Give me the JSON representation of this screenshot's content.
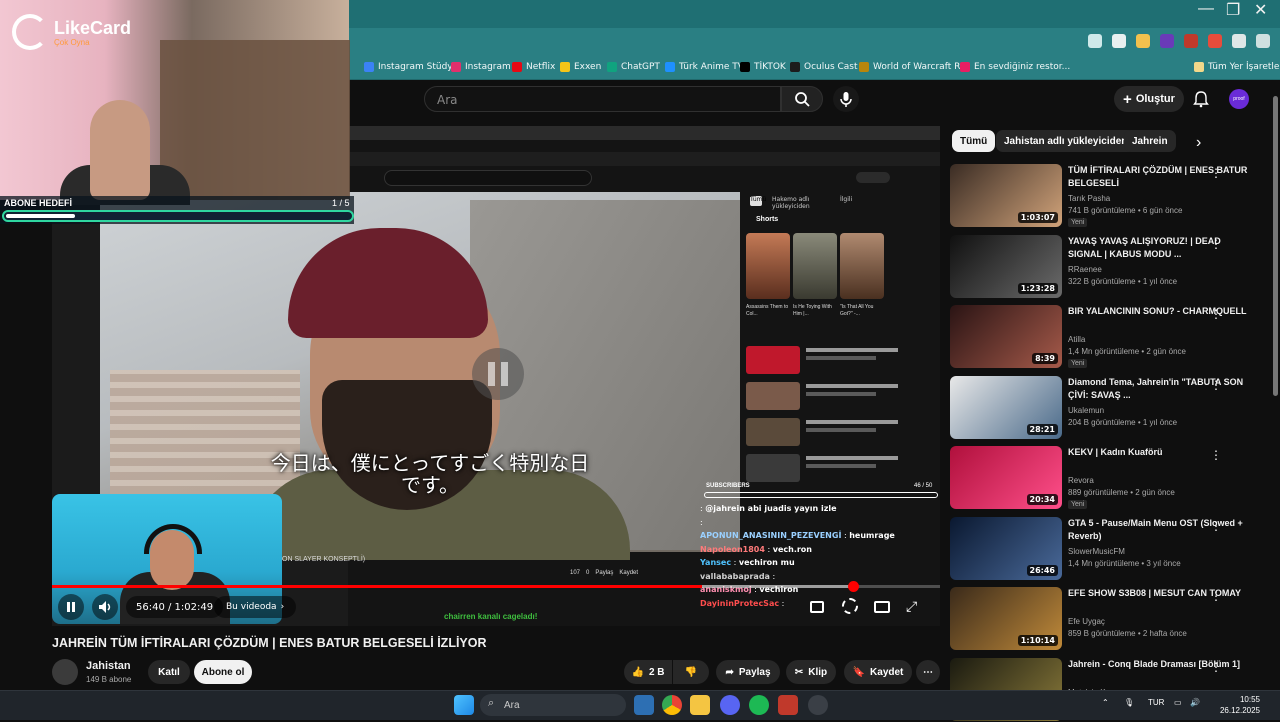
{
  "stream_overlay": {
    "logo_text": "LikeCard",
    "logo_sub": "Çok Oyna",
    "goal_label": "ABONE HEDEFİ",
    "goal_count": "1 / 5",
    "goal_progress": 0.2
  },
  "bookmarks": [
    {
      "label": "Instagram Stüdyo",
      "color": "#3b82f6"
    },
    {
      "label": "Instagram",
      "color": "#e1306c"
    },
    {
      "label": "Netflix",
      "color": "#e50914"
    },
    {
      "label": "Exxen",
      "color": "#f5c518"
    },
    {
      "label": "ChatGPT",
      "color": "#10a37f"
    },
    {
      "label": "Türk Anime TV",
      "color": "#1e90ff"
    },
    {
      "label": "TİKTOK",
      "color": "#000000"
    },
    {
      "label": "Oculus Cast",
      "color": "#1c1c1c"
    },
    {
      "label": "World of Warcraft R...",
      "color": "#b8860b"
    },
    {
      "label": "En sevdiğiniz restor...",
      "color": "#e91e63"
    }
  ],
  "bookmarks_all": "Tüm Yer İşaretleri",
  "header": {
    "search_placeholder": "Ara",
    "create_label": "Oluştur",
    "avatar_text": "proof"
  },
  "player": {
    "subtitle_line1": "今日は、僕にとってすごく特別な日",
    "subtitle_line2": "です。",
    "time": "56:40 / 1:02:49",
    "chapter": "Bu videoda",
    "progress": 0.902,
    "accent": "#ff0000"
  },
  "inner": {
    "chips": [
      "Tümü",
      "Hakemo adlı yükleyiciden",
      "İlgili"
    ],
    "shorts_label": "Shorts",
    "shorts": [
      "Assassins Them to Col...",
      "Is He Toying With Him |...",
      "\"Is That All You Got?\" -..."
    ],
    "bottom_caption": "ON SLAYER KONSEPTLİ)",
    "bottom_actions": [
      "107",
      "0",
      "Paylaş",
      "Kaydet"
    ]
  },
  "chat": {
    "sub_label": "SUBSCRIBERS",
    "sub_count": "46 / 50",
    "messages": [
      {
        "user": "",
        "text": "@jahrein abi juadis yayın izle",
        "color": "#3fbf3f"
      },
      {
        "user": "",
        "text": "",
        "color": "#ff4d4d"
      },
      {
        "user": "APONUN_ANASININ_PEZEVENGİ",
        "text": "heumrage",
        "color": "#9ad0ff"
      },
      {
        "user": "Napoleon1804",
        "text": "vech.ron",
        "color": "#ff7a7a"
      },
      {
        "user": "Yansec",
        "text": "vechiron mu",
        "color": "#4fc3ff"
      },
      {
        "user": "vallababaprada",
        "text": "",
        "color": "#d0d0d0"
      },
      {
        "user": "ananiskmoj",
        "text": "vechiron",
        "color": "#ff8fb1"
      },
      {
        "user": "DayininProtecSac",
        "text": "",
        "color": "#ff4d4d"
      }
    ],
    "footer": "chairren kanalı cageladı!"
  },
  "video": {
    "title": "JAHREİN TÜM İFTİRALARI ÇÖZDÜM | ENES BATUR BELGESELİ İZLİYOR",
    "channel": "Jahistan",
    "subs": "149 B abone",
    "join": "Katıl",
    "subscribe": "Abone ol",
    "likes": "2 B",
    "share": "Paylaş",
    "clip": "Klip",
    "save": "Kaydet"
  },
  "right_chips": [
    "Tümü",
    "Jahistan adlı yükleyiciden",
    "Jahrein"
  ],
  "recommendations": [
    {
      "title": "TÜM İFTİRALARI ÇÖZDÜM | ENES BATUR BELGESELİ",
      "channel": "Tarık Pasha",
      "meta": "741 B görüntüleme • 6 gün önce",
      "badge": "Yeni",
      "duration": "1:03:07",
      "c1": "#3a2c24",
      "c2": "#d1a37a"
    },
    {
      "title": "YAVAŞ YAVAŞ ALIŞIYORUZ! | DEAD SIGNAL | KABUS MODU ...",
      "channel": "RRaenee",
      "meta": "322 B görüntüleme • 1 yıl önce",
      "badge": "",
      "duration": "1:23:28",
      "c1": "#101010",
      "c2": "#6b6b6b"
    },
    {
      "title": "BIR YALANCININ SONU? - CHARMQUELL",
      "channel": "Atilla",
      "meta": "1,4 Mn görüntüleme • 2 gün önce",
      "badge": "Yeni",
      "duration": "8:39",
      "c1": "#2a1414",
      "c2": "#a65a4a"
    },
    {
      "title": "Diamond Tema, Jahrein'in \"TABUTA SON ÇİVİ: SAVAŞ ...",
      "channel": "Ukalemun",
      "meta": "204 B görüntüleme • 1 yıl önce",
      "badge": "",
      "duration": "28:21",
      "c1": "#e8e8e8",
      "c2": "#4a6a8a"
    },
    {
      "title": "KEKV | Kadın Kuaförü",
      "channel": "Revora",
      "meta": "889 görüntüleme • 2 gün önce",
      "badge": "Yeni",
      "duration": "20:34",
      "c1": "#b0103c",
      "c2": "#ff4f8a"
    },
    {
      "title": "GTA 5 - Pause/Main Menu OST (Slowed + Reverb)",
      "channel": "SlowerMusicFM",
      "meta": "1,4 Mn görüntüleme • 3 yıl önce",
      "badge": "",
      "duration": "26:46",
      "c1": "#0a1830",
      "c2": "#4a6a9a"
    },
    {
      "title": "EFE SHOW S3B08 | MESUT CAN TOMAY",
      "channel": "Efe Uygaç",
      "meta": "859 B görüntüleme • 2 hafta önce",
      "badge": "",
      "duration": "1:10:14",
      "c1": "#3a2a1a",
      "c2": "#c08a3a"
    },
    {
      "title": "Jahrein - Conq Blade Draması [Bölüm 1]",
      "channel": "Mete'nin Kurusu",
      "meta": "",
      "badge": "",
      "duration": "",
      "c1": "#1a1a10",
      "c2": "#8a7a3a"
    }
  ],
  "taskbar": {
    "search": "Ara",
    "lang": "TUR",
    "time": "10:55",
    "date": "26.12.2025"
  }
}
